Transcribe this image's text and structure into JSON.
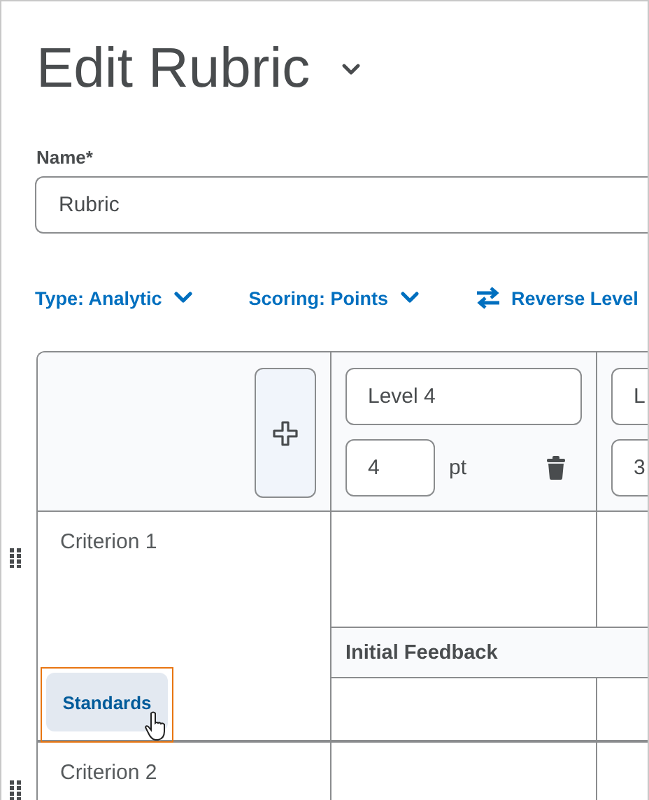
{
  "title": "Edit Rubric",
  "name_field": {
    "label": "Name*",
    "value": "Rubric"
  },
  "toolbar": [
    {
      "kind": "dropdown",
      "label": "Type: Analytic"
    },
    {
      "kind": "dropdown",
      "label": "Scoring: Points"
    },
    {
      "kind": "reverse",
      "label": "Reverse Level"
    }
  ],
  "levels": [
    {
      "name": "Level 4",
      "points": "4",
      "unit": "pt"
    },
    {
      "name": "L",
      "points": "3"
    }
  ],
  "criteria": [
    {
      "name": "Criterion 1",
      "feedback_label": "Initial Feedback",
      "standards": {
        "label": "Standards",
        "focused": true
      }
    },
    {
      "name": "Criterion 2"
    }
  ]
}
